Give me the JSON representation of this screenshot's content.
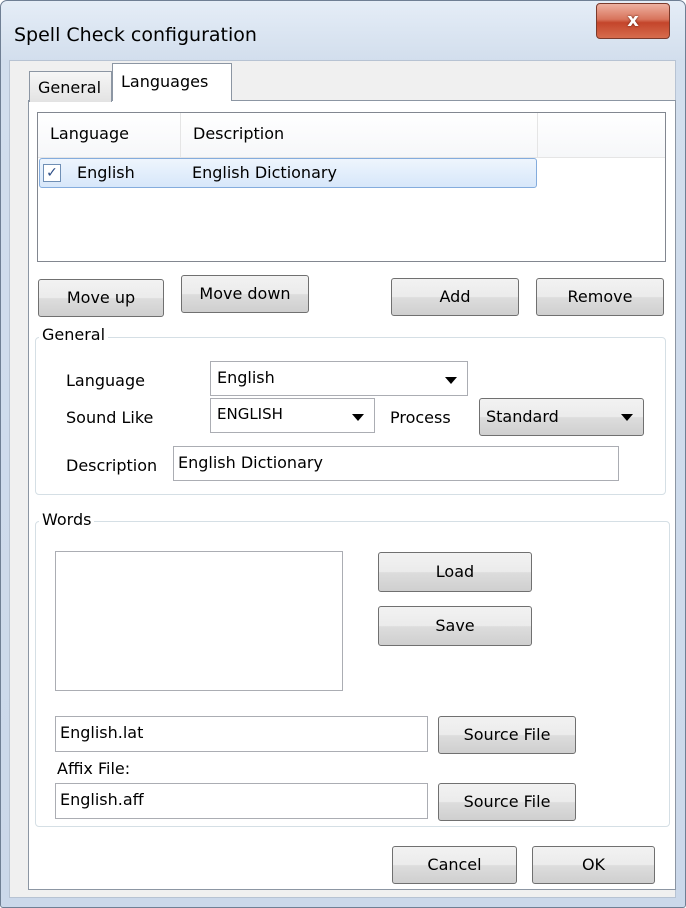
{
  "window": {
    "title": "Spell Check configuration",
    "close_glyph": "x"
  },
  "tabs": [
    {
      "label": "General",
      "active": false
    },
    {
      "label": "Languages",
      "active": true
    }
  ],
  "language_list": {
    "columns": [
      "Language",
      "Description"
    ],
    "rows": [
      {
        "checked": true,
        "check_glyph": "✓",
        "language": "English",
        "description": "English Dictionary"
      }
    ]
  },
  "list_buttons": {
    "move_up": "Move up",
    "move_down": "Move down",
    "add": "Add",
    "remove": "Remove"
  },
  "general_group": {
    "legend": "General",
    "language_label": "Language",
    "language_value": "English",
    "sound_like_label": "Sound Like",
    "sound_like_value": "ENGLISH",
    "process_label": "Process",
    "process_value": "Standard",
    "description_label": "Description",
    "description_value": "English Dictionary"
  },
  "words_group": {
    "legend": "Words",
    "load": "Load",
    "save": "Save",
    "word_file_value": "English.lat",
    "source_file_1": "Source File",
    "affix_label": "Affix File:",
    "affix_file_value": "English.aff",
    "source_file_2": "Source File"
  },
  "footer": {
    "cancel": "Cancel",
    "ok": "OK"
  },
  "colors": {
    "frame": "#cbd8ea",
    "close_button": "#c4452b",
    "selection": "#d7e7fa"
  }
}
